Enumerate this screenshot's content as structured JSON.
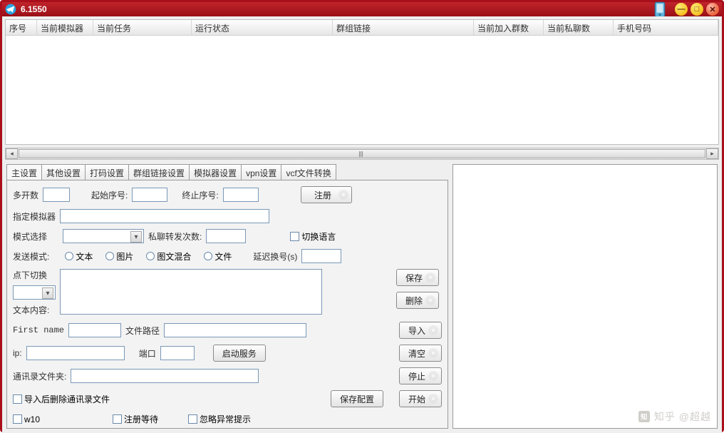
{
  "window": {
    "title": "6.1550"
  },
  "columns": [
    {
      "label": "序号",
      "width": 44
    },
    {
      "label": "当前模拟器",
      "width": 79
    },
    {
      "label": "当前任务",
      "width": 138
    },
    {
      "label": "运行状态",
      "width": 198
    },
    {
      "label": "群组链接",
      "width": 198
    },
    {
      "label": "当前加入群数",
      "width": 98
    },
    {
      "label": "当前私聊数",
      "width": 98
    },
    {
      "label": "手机号码",
      "width": 140
    }
  ],
  "tabs": [
    "主设置",
    "其他设置",
    "打码设置",
    "群组链接设置",
    "模拟器设置",
    "vpn设置",
    "vcf文件转换"
  ],
  "activeTab": 0,
  "form": {
    "multiOpen": {
      "label": "多开数"
    },
    "startIdx": {
      "label": "起始序号:"
    },
    "endIdx": {
      "label": "终止序号:"
    },
    "registerBtn": "注册",
    "assignSim": {
      "label": "指定模拟器"
    },
    "modeSelect": {
      "label": "模式选择"
    },
    "pmForward": {
      "label": "私聊转发次数:"
    },
    "switchLang": {
      "label": "切换语言"
    },
    "sendMode": {
      "label": "发送模式:"
    },
    "sendOptions": [
      "文本",
      "图片",
      "图文混合",
      "文件"
    ],
    "delay": {
      "label": "延迟换号(s)"
    },
    "clickSwitch": {
      "label": "点下切换"
    },
    "textContent": {
      "label": "文本内容:"
    },
    "firstName": {
      "label": "First name"
    },
    "filePath": {
      "label": "文件路径"
    },
    "ip": {
      "label": "ip:"
    },
    "port": {
      "label": "端口"
    },
    "startService": "启动服务",
    "contacts": {
      "label": "通讯录文件夹:"
    },
    "delAfterImport": {
      "label": "导入后删除通讯录文件"
    },
    "saveConfig": "保存配置",
    "w10": {
      "label": "w10"
    },
    "waitReg": {
      "label": "注册等待"
    },
    "ignoreErr": {
      "label": "忽略异常提示"
    }
  },
  "sideButtons": {
    "save": "保存",
    "delete": "删除",
    "import": "导入",
    "clear": "清空",
    "stop": "停止",
    "start": "开始"
  },
  "watermark": "知乎 @超越"
}
